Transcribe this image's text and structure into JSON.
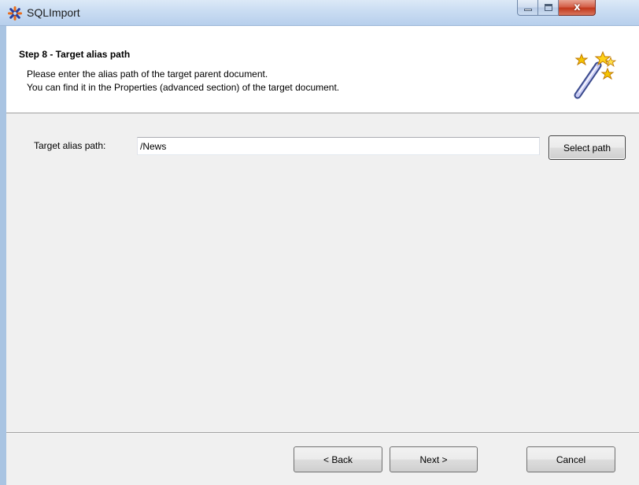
{
  "window": {
    "title": "SQLImport",
    "icon": "app-asterisk-icon",
    "caption_icons": [
      "minimize-icon",
      "maximize-icon",
      "close-icon"
    ],
    "close_glyph": "x"
  },
  "header": {
    "step_title": "Step 8 - Target alias path",
    "description_line1": "Please enter the alias path of the target parent document.",
    "description_line2": "You can find it in the Properties (advanced section) of the target document.",
    "icon": "magic-wand-icon"
  },
  "form": {
    "target_alias_label": "Target alias path:",
    "target_alias_value": "/News",
    "select_path_label": "Select path"
  },
  "footer": {
    "back_label": "< Back",
    "next_label": "Next >",
    "cancel_label": "Cancel"
  },
  "colors": {
    "title_bar": "#c9dcf2",
    "close_button": "#c2381c",
    "dialog_background": "#f0f0f0",
    "header_background": "#ffffff"
  }
}
